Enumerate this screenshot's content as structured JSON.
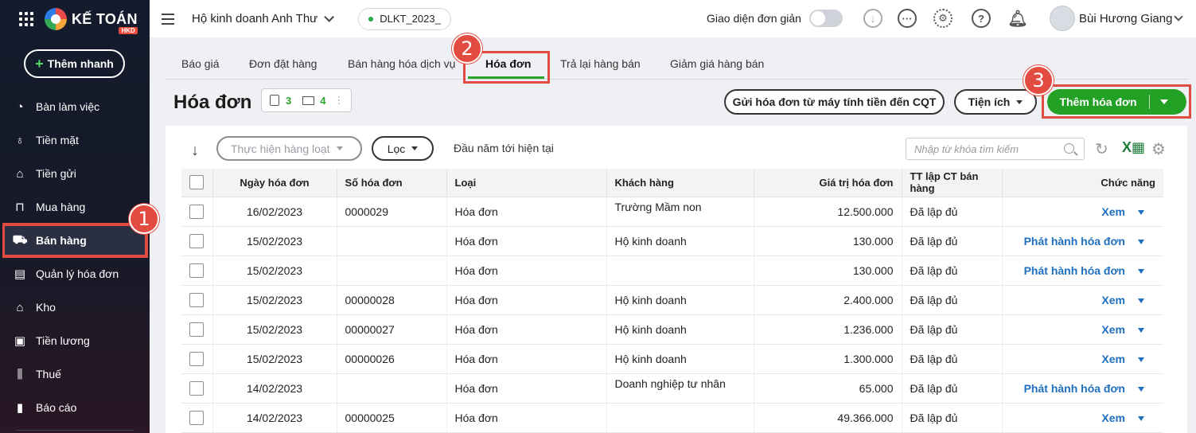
{
  "app": {
    "logo_text": "KẾ TOÁN",
    "logo_badge": "HKD",
    "quick_add": "Thêm nhanh"
  },
  "sidebar": {
    "items": [
      {
        "label": "Bàn làm việc",
        "icon": "dashboard-icon"
      },
      {
        "label": "Tiền mặt",
        "icon": "money-bag-icon"
      },
      {
        "label": "Tiền gửi",
        "icon": "bank-icon"
      },
      {
        "label": "Mua hàng",
        "icon": "shopping-bag-icon"
      },
      {
        "label": "Bán hàng",
        "icon": "cart-icon",
        "active": true
      },
      {
        "label": "Quản lý hóa đơn",
        "icon": "invoice-icon"
      },
      {
        "label": "Kho",
        "icon": "warehouse-icon"
      },
      {
        "label": "Tiền lương",
        "icon": "salary-icon"
      },
      {
        "label": "Thuế",
        "icon": "tax-icon"
      },
      {
        "label": "Báo cáo",
        "icon": "report-icon"
      }
    ]
  },
  "header": {
    "company": "Hộ kinh doanh Anh Thư",
    "database": "DLKT_2023_",
    "simple_mode_label": "Giao diện đơn giản",
    "user_name": "Bùi Hương Giang"
  },
  "tabs": [
    {
      "label": "Báo giá"
    },
    {
      "label": "Đơn đặt hàng"
    },
    {
      "label": "Bán hàng hóa dịch vụ"
    },
    {
      "label": "Hóa đơn",
      "active": true
    },
    {
      "label": "Trả lại hàng bán"
    },
    {
      "label": "Giảm giá hàng bán"
    }
  ],
  "page": {
    "title": "Hóa đơn",
    "count_docs": "3",
    "count_mail": "4",
    "btn_send_cqt": "Gửi hóa đơn từ máy tính tiền đến CQT",
    "btn_utilities": "Tiện ích",
    "btn_add_invoice": "Thêm hóa đơn"
  },
  "toolbar": {
    "bulk_action": "Thực hiện hàng loạt",
    "filter": "Lọc",
    "period": "Đầu năm tới hiện tại",
    "search_placeholder": "Nhập từ khóa tìm kiếm"
  },
  "annotations": [
    "1",
    "2",
    "3"
  ],
  "table": {
    "headers": [
      "Ngày hóa đơn",
      "Số hóa đơn",
      "Loại",
      "Khách hàng",
      "Giá trị hóa đơn",
      "TT lập CT bán hàng",
      "Chức năng"
    ],
    "rows": [
      {
        "date": "16/02/2023",
        "number": "0000029",
        "type": "Hóa đơn",
        "customer": "Trường Mầm non",
        "value": "12.500.000",
        "status": "Đã lập đủ",
        "action": "Xem"
      },
      {
        "date": "15/02/2023",
        "number": "",
        "type": "Hóa đơn",
        "customer": "Hộ kinh doanh",
        "value": "130.000",
        "status": "Đã lập đủ",
        "action": "Phát hành hóa đơn"
      },
      {
        "date": "15/02/2023",
        "number": "",
        "type": "Hóa đơn",
        "customer": "",
        "value": "130.000",
        "status": "Đã lập đủ",
        "action": "Phát hành hóa đơn"
      },
      {
        "date": "15/02/2023",
        "number": "00000028",
        "type": "Hóa đơn",
        "customer": "Hộ kinh doanh",
        "value": "2.400.000",
        "status": "Đã lập đủ",
        "action": "Xem"
      },
      {
        "date": "15/02/2023",
        "number": "00000027",
        "type": "Hóa đơn",
        "customer": "Hộ kinh doanh",
        "value": "1.236.000",
        "status": "Đã lập đủ",
        "action": "Xem"
      },
      {
        "date": "15/02/2023",
        "number": "00000026",
        "type": "Hóa đơn",
        "customer": "Hộ kinh doanh",
        "value": "1.300.000",
        "status": "Đã lập đủ",
        "action": "Xem"
      },
      {
        "date": "14/02/2023",
        "number": "",
        "type": "Hóa đơn",
        "customer": "Doanh nghiệp tư nhân",
        "value": "65.000",
        "status": "Đã lập đủ",
        "action": "Phát hành hóa đơn"
      },
      {
        "date": "14/02/2023",
        "number": "00000025",
        "type": "Hóa đơn",
        "customer": "",
        "value": "49.366.000",
        "status": "Đã lập đủ",
        "action": "Xem"
      }
    ]
  }
}
